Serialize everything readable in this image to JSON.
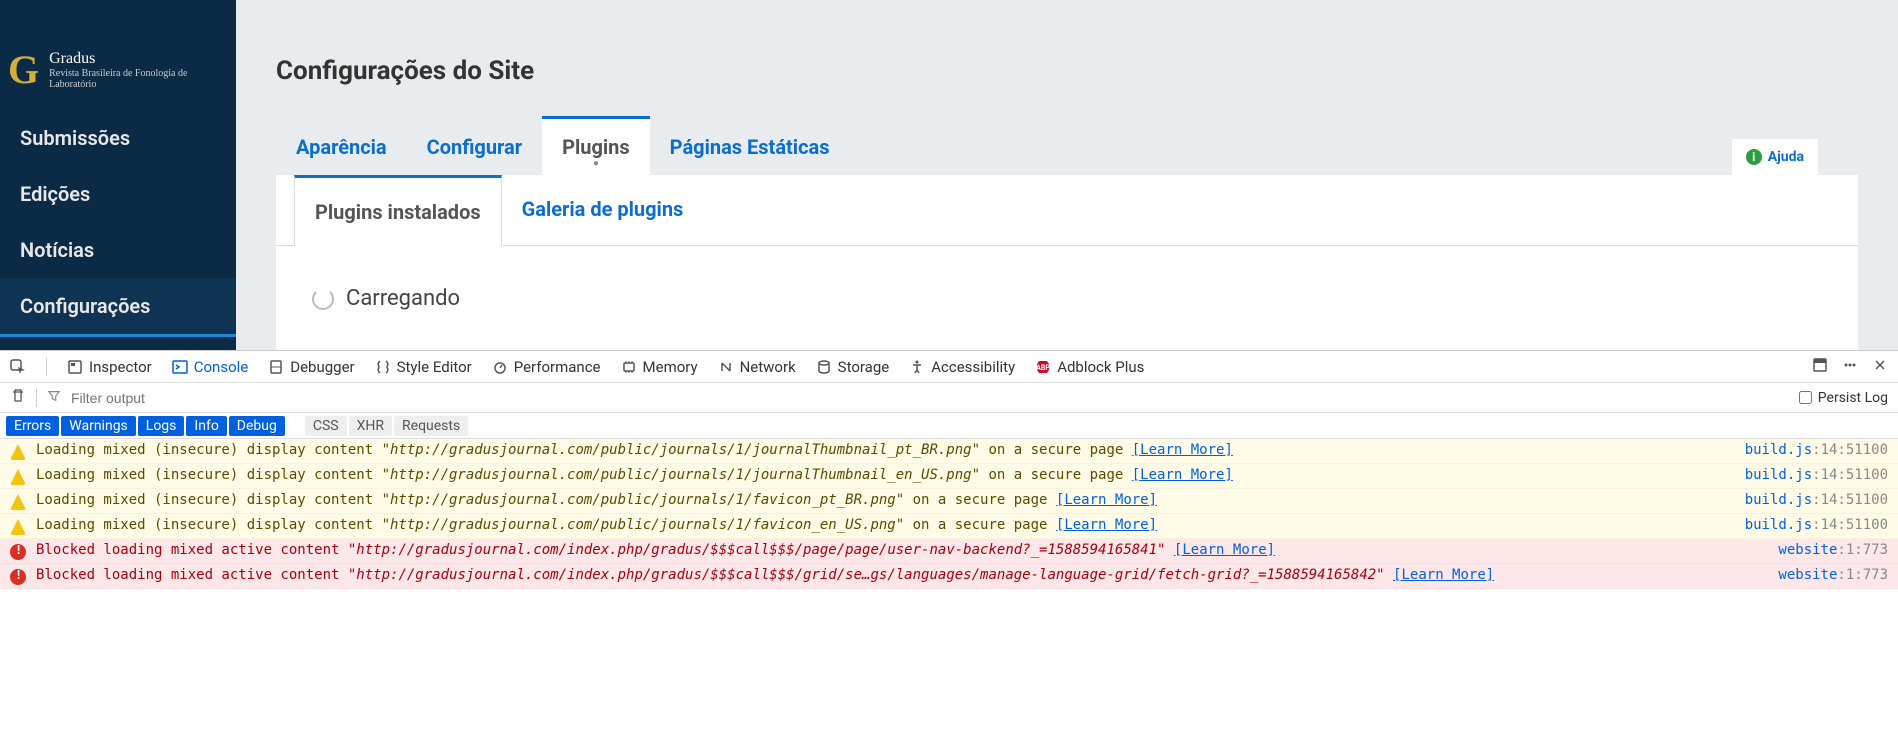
{
  "top_loading": "Carregando",
  "logo": {
    "letter": "G",
    "title": "Gradus",
    "subtitle": "Revista Brasileira de Fonologia de Laboratório"
  },
  "sidebar": {
    "items": [
      {
        "label": "Submissões"
      },
      {
        "label": "Edições"
      },
      {
        "label": "Notícias"
      },
      {
        "label": "Configurações"
      }
    ]
  },
  "page_title": "Configurações do Site",
  "tabs": [
    {
      "label": "Aparência"
    },
    {
      "label": "Configurar"
    },
    {
      "label": "Plugins"
    },
    {
      "label": "Páginas Estáticas"
    }
  ],
  "help_label": "Ajuda",
  "subtabs": [
    {
      "label": "Plugins instalados"
    },
    {
      "label": "Galeria de plugins"
    }
  ],
  "panel_loading": "Carregando",
  "devtools": {
    "tools": [
      {
        "label": "Inspector"
      },
      {
        "label": "Console"
      },
      {
        "label": "Debugger"
      },
      {
        "label": "Style Editor"
      },
      {
        "label": "Performance"
      },
      {
        "label": "Memory"
      },
      {
        "label": "Network"
      },
      {
        "label": "Storage"
      },
      {
        "label": "Accessibility"
      },
      {
        "label": "Adblock Plus"
      }
    ],
    "filter_placeholder": "Filter output",
    "persist_label": "Persist Log",
    "categories_on": [
      "Errors",
      "Warnings",
      "Logs",
      "Info",
      "Debug"
    ],
    "categories_off": [
      "CSS",
      "XHR",
      "Requests"
    ],
    "messages": [
      {
        "type": "warn",
        "prefix": "Loading mixed (insecure) display content ",
        "url": "\"http://gradusjournal.com/public/journals/1/journalThumbnail_pt_BR.png\"",
        "suffix": " on a secure page ",
        "learn": "[Learn More]",
        "src_file": "build.js",
        "src_loc": ":14:51100"
      },
      {
        "type": "warn",
        "prefix": "Loading mixed (insecure) display content ",
        "url": "\"http://gradusjournal.com/public/journals/1/journalThumbnail_en_US.png\"",
        "suffix": " on a secure page ",
        "learn": "[Learn More]",
        "src_file": "build.js",
        "src_loc": ":14:51100"
      },
      {
        "type": "warn",
        "prefix": "Loading mixed (insecure) display content ",
        "url": "\"http://gradusjournal.com/public/journals/1/favicon_pt_BR.png\"",
        "suffix": " on a secure page ",
        "learn": "[Learn More]",
        "src_file": "build.js",
        "src_loc": ":14:51100"
      },
      {
        "type": "warn",
        "prefix": "Loading mixed (insecure) display content ",
        "url": "\"http://gradusjournal.com/public/journals/1/favicon_en_US.png\"",
        "suffix": " on a secure page ",
        "learn": "[Learn More]",
        "src_file": "build.js",
        "src_loc": ":14:51100"
      },
      {
        "type": "err",
        "prefix": "Blocked loading mixed active content ",
        "url": "\"http://gradusjournal.com/index.php/gradus/$$$call$$$/page/page/user-nav-backend?_=1588594165841\"",
        "suffix": " ",
        "learn": "[Learn More]",
        "src_file": "website",
        "src_loc": ":1:773"
      },
      {
        "type": "err",
        "prefix": "Blocked loading mixed active content ",
        "url": "\"http://gradusjournal.com/index.php/gradus/$$$call$$$/grid/se…gs/languages/manage-language-grid/fetch-grid?_=1588594165842\"",
        "suffix": " ",
        "learn": "[Learn More]",
        "src_file": "website",
        "src_loc": ":1:773"
      }
    ]
  }
}
